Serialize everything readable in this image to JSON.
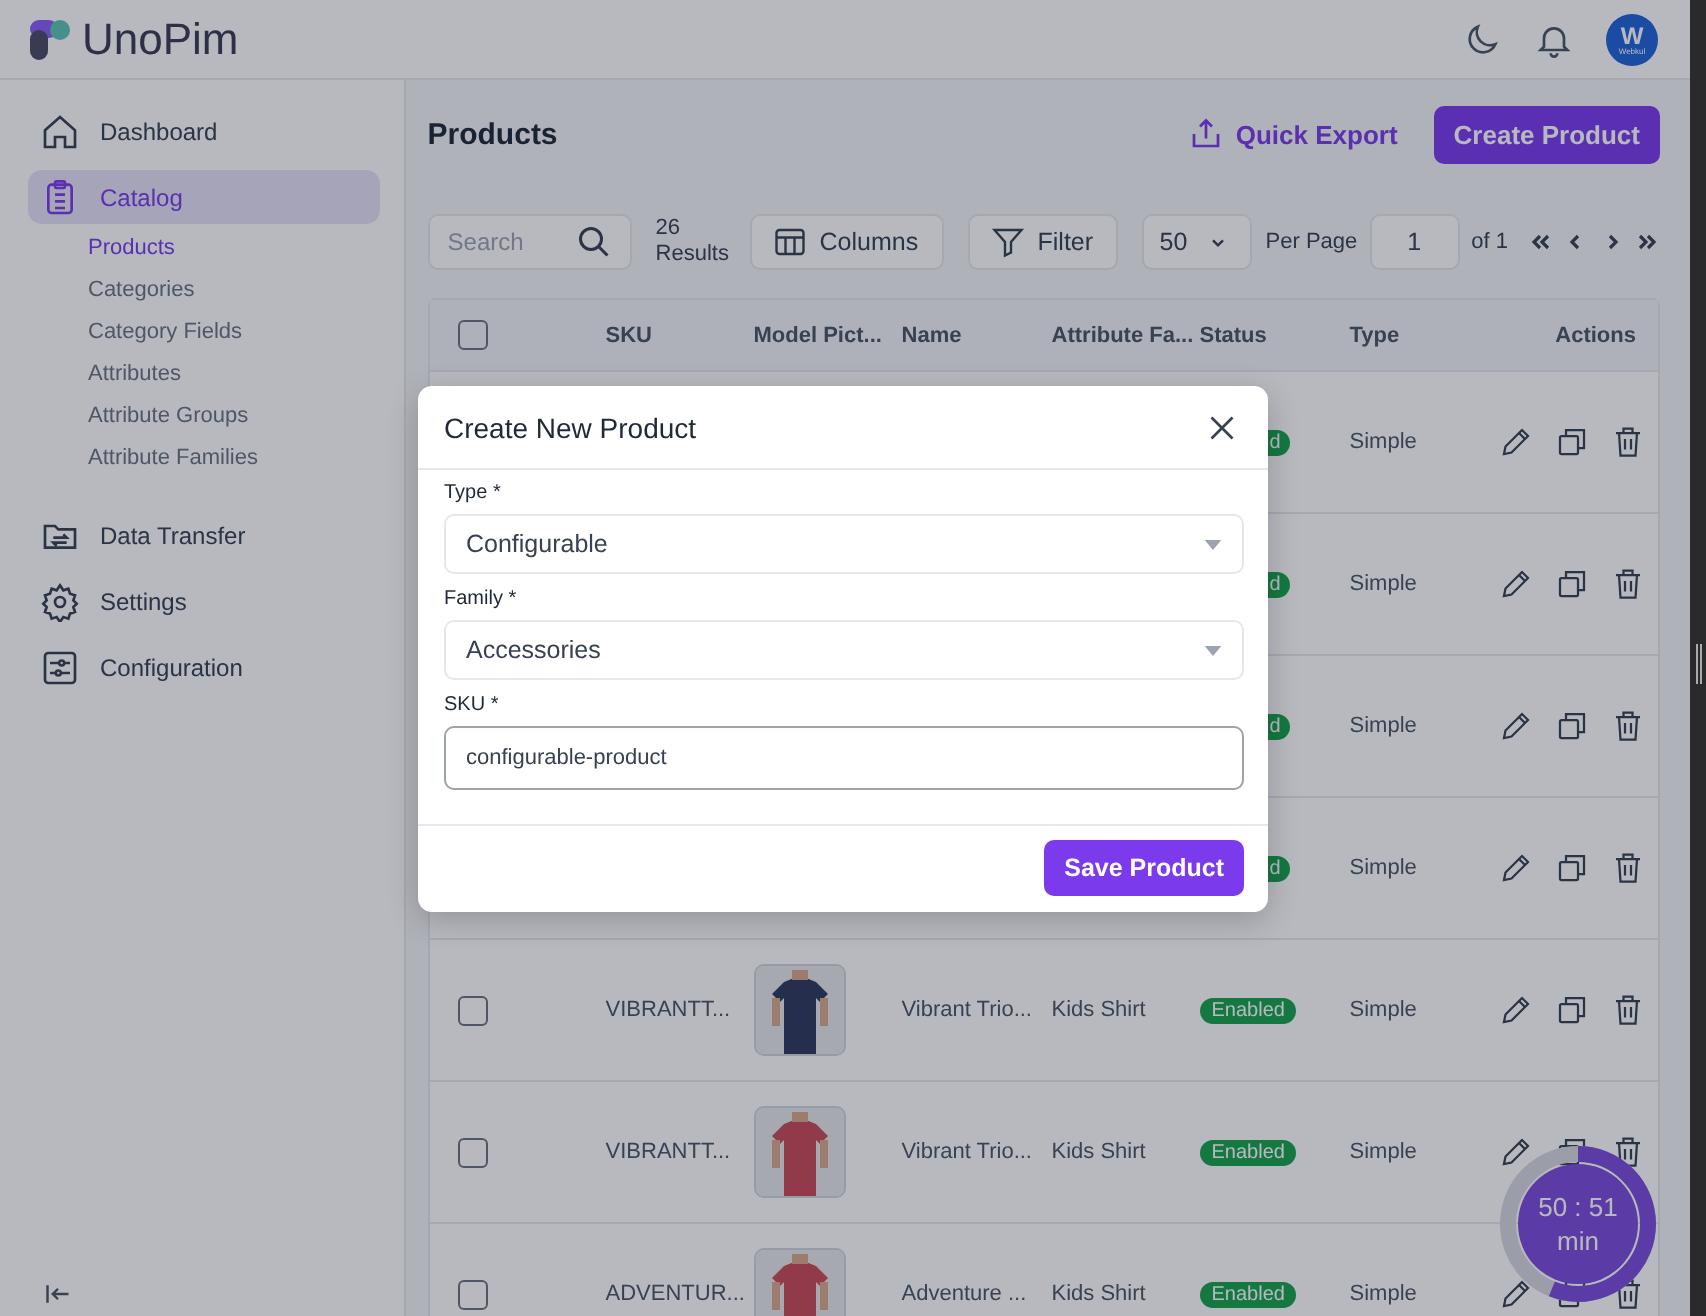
{
  "header": {
    "logo": "UnoPim",
    "avatar_letter": "W",
    "avatar_caption": "Webkul"
  },
  "sidebar": {
    "items": [
      {
        "label": "Dashboard",
        "selected": false
      },
      {
        "label": "Catalog",
        "selected": true,
        "children": [
          {
            "label": "Products",
            "selected": true
          },
          {
            "label": "Categories",
            "selected": false
          },
          {
            "label": "Category Fields",
            "selected": false
          },
          {
            "label": "Attributes",
            "selected": false
          },
          {
            "label": "Attribute Groups",
            "selected": false
          },
          {
            "label": "Attribute Families",
            "selected": false
          }
        ]
      },
      {
        "label": "Data Transfer",
        "selected": false
      },
      {
        "label": "Settings",
        "selected": false
      },
      {
        "label": "Configuration",
        "selected": false
      }
    ]
  },
  "page": {
    "title": "Products",
    "quick_export": "Quick Export",
    "create_button": "Create Product"
  },
  "toolbar": {
    "search": {
      "placeholder": "Search"
    },
    "results": "26 Results",
    "columns_button": "Columns",
    "filter_button": "Filter",
    "per_page_value": "50",
    "per_page_label": "Per Page",
    "page": "1",
    "page_total": "of 1"
  },
  "table": {
    "select_all_checked": false,
    "columns": [
      "SKU",
      "Model Pict...",
      "Name",
      "Attribute Fa...",
      "Status",
      "Type",
      "Actions"
    ],
    "rows": [
      {
        "status": "d",
        "type": "Simple"
      },
      {
        "status": "d",
        "type": "Simple"
      },
      {
        "status": "d",
        "type": "Simple"
      },
      {
        "status": "d",
        "type": "Simple"
      },
      {
        "checked": false,
        "sku": "VIBRANTT...",
        "name": "Vibrant Trio...",
        "family": "Kids Shirt",
        "status": "Enabled",
        "type": "Simple"
      },
      {
        "checked": false,
        "sku": "VIBRANTT...",
        "name": "Vibrant Trio...",
        "family": "Kids Shirt",
        "status": "Enabled",
        "type": "Simple"
      },
      {
        "checked": false,
        "sku": "ADVENTUR...",
        "name": "Adventure ...",
        "family": "Kids Shirt",
        "status": "Enabled",
        "type": "Simple"
      }
    ]
  },
  "modal": {
    "title": "Create New Product",
    "fields": [
      {
        "kind": "select",
        "label": "Type *",
        "value": "Configurable"
      },
      {
        "kind": "select",
        "label": "Family *",
        "value": "Accessories"
      },
      {
        "kind": "text",
        "label": "SKU *",
        "value": "configurable-product"
      }
    ],
    "save_button": "Save Product"
  },
  "timer": {
    "time": "50 : 51",
    "unit": "min",
    "level": 0.56
  }
}
